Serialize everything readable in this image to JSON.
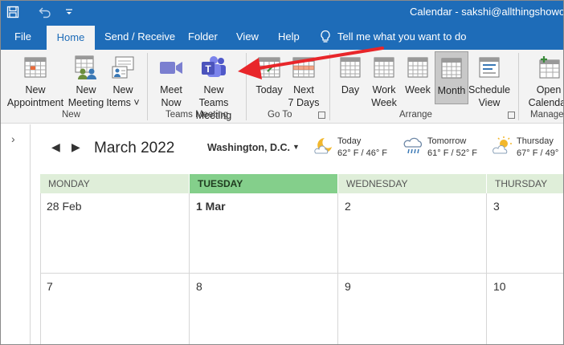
{
  "titlebar": {
    "title": "Calendar - sakshi@allthingshoworg.c",
    "color": "#1e6cb8"
  },
  "tabs": [
    {
      "label": "File",
      "active": false
    },
    {
      "label": "Home",
      "active": true
    },
    {
      "label": "Send / Receive",
      "active": false
    },
    {
      "label": "Folder",
      "active": false
    },
    {
      "label": "View",
      "active": false
    },
    {
      "label": "Help",
      "active": false
    }
  ],
  "tellme": {
    "label": "Tell me what you want to do",
    "icon": "lightbulb-icon"
  },
  "ribbon": {
    "new": {
      "new_appointment": {
        "line1": "New",
        "line2": "Appointment"
      },
      "new_meeting": {
        "line1": "New",
        "line2": "Meeting"
      },
      "new_items": {
        "line1": "New",
        "line2": "Items ˅"
      },
      "group_label": "New"
    },
    "teams": {
      "meet_now": {
        "line1": "Meet",
        "line2": "Now"
      },
      "new_teams_meeting": {
        "line1": "New Teams",
        "line2": "Meeting"
      },
      "group_label": "Teams Meeting"
    },
    "goto": {
      "today": {
        "line1": "Today"
      },
      "next7": {
        "line1": "Next",
        "line2": "7 Days"
      },
      "group_label": "Go To"
    },
    "arrange": {
      "day": {
        "line1": "Day"
      },
      "work_week": {
        "line1": "Work",
        "line2": "Week"
      },
      "week": {
        "line1": "Week"
      },
      "month": {
        "line1": "Month",
        "selected": true
      },
      "schedule": {
        "line1": "Schedule",
        "line2": "View"
      },
      "group_label": "Arrange"
    },
    "manage": {
      "open_calendar": {
        "line1": "Open",
        "line2": "Calendar"
      },
      "group_label": "Manage"
    }
  },
  "nav": {
    "month_title": "March 2022",
    "location": "Washington, D.C."
  },
  "weather": [
    {
      "day": "Today",
      "temp": "62° F / 46° F",
      "icon": "moon-cloud-icon"
    },
    {
      "day": "Tomorrow",
      "temp": "61° F / 52° F",
      "icon": "rain-cloud-icon"
    },
    {
      "day": "Thursday",
      "temp": "67° F / 49°",
      "icon": "sun-cloud-icon"
    }
  ],
  "calendar": {
    "days": [
      "MONDAY",
      "TUESDAY",
      "WEDNESDAY",
      "THURSDAY"
    ],
    "today_index": 1,
    "week1": [
      "28 Feb",
      "1 Mar",
      "2",
      "3"
    ],
    "week2": [
      "7",
      "8",
      "9",
      "10"
    ]
  },
  "colors": {
    "accent": "#1e6cb8",
    "today_header": "#84cf8b",
    "day_header": "#dfeed9",
    "arrow": "#e8262a"
  }
}
